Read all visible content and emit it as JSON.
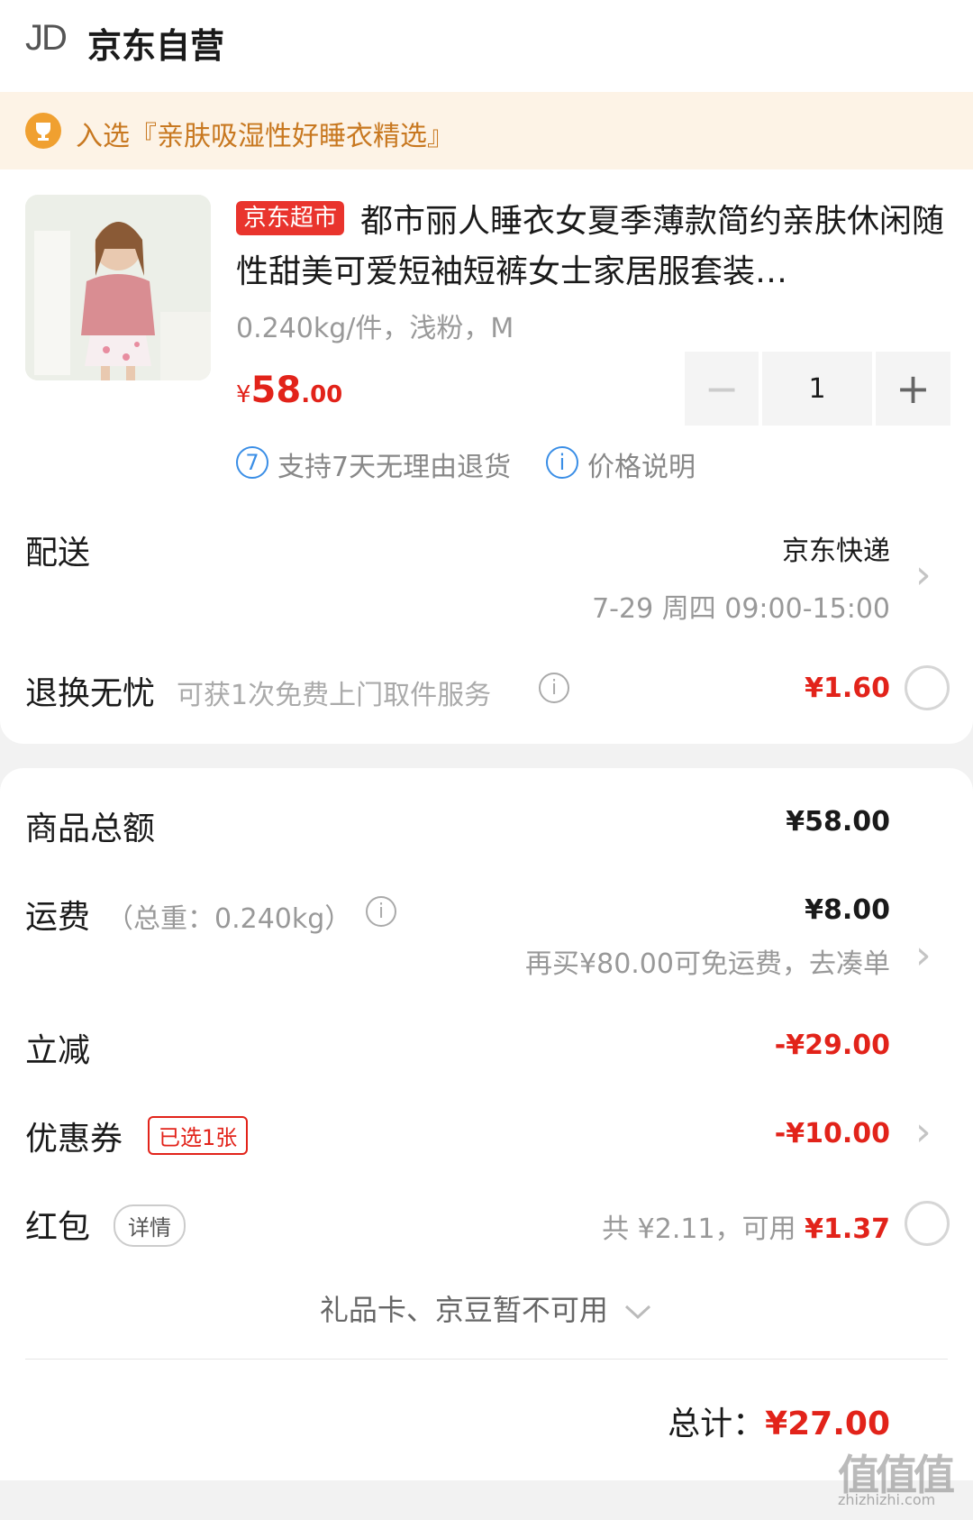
{
  "header": {
    "logo": "JD",
    "store_name": "京东自营"
  },
  "banner": {
    "icon": "trophy-icon",
    "text": "入选『亲肤吸湿性好睡衣精选』"
  },
  "product": {
    "tag": "京东超市",
    "title": "都市丽人睡衣女夏季薄款简约亲肤休闲随性甜美可爱短袖短裤女士家居服套装…",
    "spec": "0.240kg/件，浅粉，M",
    "price_currency": "¥",
    "price_int": "58",
    "price_dec": ".00",
    "quantity": "1",
    "minus_symbol": "−",
    "plus_symbol": "+",
    "service_return_icon": "7",
    "service_return": "支持7天无理由退货",
    "price_info_icon": "i",
    "price_info": "价格说明"
  },
  "delivery": {
    "label": "配送",
    "carrier": "京东快递",
    "time": "7-29 周四 09:00-15:00"
  },
  "return_service": {
    "label": "退换无忧",
    "desc": "可获1次免费上门取件服务",
    "price": "¥1.60"
  },
  "summary": {
    "goods_total_label": "商品总额",
    "goods_total": "¥58.00",
    "shipping_label": "运费",
    "shipping_weight": "（总重：0.240kg）",
    "shipping_fee": "¥8.00",
    "shipping_tip": "再买¥80.00可免运费，去凑单",
    "discount_label": "立减",
    "discount": "-¥29.00",
    "coupon_label": "优惠券",
    "coupon_badge": "已选1张",
    "coupon_value": "-¥10.00",
    "redpacket_label": "红包",
    "redpacket_detail": "详情",
    "redpacket_total": "共 ¥2.11，可用",
    "redpacket_usable": "¥1.37",
    "giftcard_text": "礼品卡、京豆暂不可用",
    "total_label": "总计：",
    "total_value": "¥27.00"
  },
  "watermark": {
    "text": "值值值",
    "url": "zhizhizhi.com"
  },
  "colors": {
    "accent_red": "#e2231a",
    "banner_bg": "#fdf3e6",
    "banner_text": "#c87820",
    "service_blue": "#3a8ee6"
  }
}
